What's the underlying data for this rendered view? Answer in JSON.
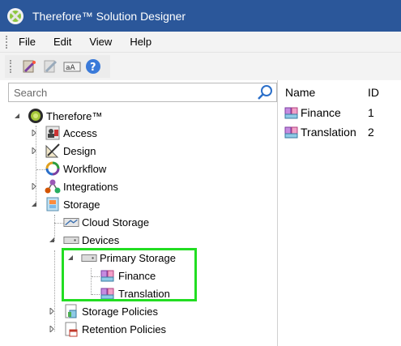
{
  "window": {
    "title": "Therefore™ Solution Designer"
  },
  "menu": {
    "items": [
      "File",
      "Edit",
      "View",
      "Help"
    ]
  },
  "toolbar": {
    "buttons": [
      "wand-icon",
      "wand-disabled-icon",
      "translate-icon",
      "help-icon"
    ]
  },
  "search": {
    "placeholder": "Search"
  },
  "tree": {
    "root": "Therefore™",
    "access": "Access",
    "design": "Design",
    "workflow": "Workflow",
    "integrations": "Integrations",
    "storage": "Storage",
    "cloud_storage": "Cloud Storage",
    "devices": "Devices",
    "primary_storage": "Primary Storage",
    "finance": "Finance",
    "translation": "Translation",
    "storage_policies": "Storage Policies",
    "retention_policies": "Retention Policies"
  },
  "list": {
    "columns": {
      "name": "Name",
      "id": "ID"
    },
    "rows": [
      {
        "name": "Finance",
        "id": "1"
      },
      {
        "name": "Translation",
        "id": "2"
      }
    ]
  },
  "colors": {
    "titlebar": "#2b579a",
    "highlight": "#22dd22"
  }
}
